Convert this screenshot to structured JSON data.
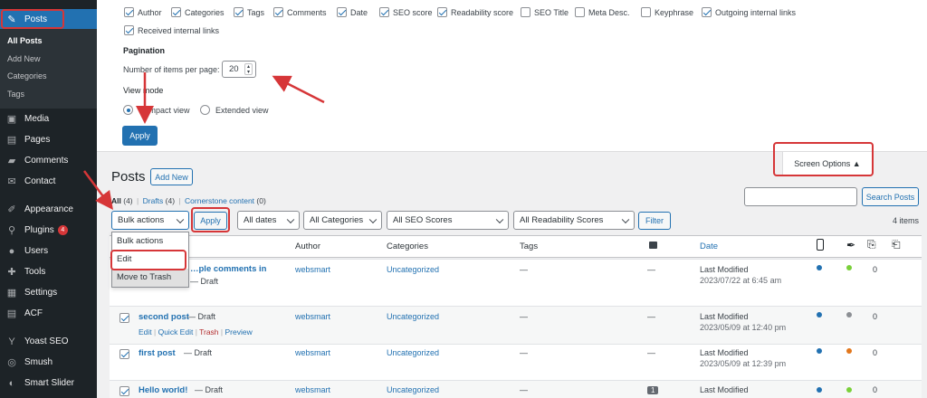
{
  "sidebar": {
    "items_top": [
      {
        "label": "Posts",
        "icon": "pushpin-icon",
        "current": true
      }
    ],
    "submenu": [
      "All Posts",
      "Add New",
      "Categories",
      "Tags"
    ],
    "items": [
      {
        "label": "Media",
        "icon": "media-icon"
      },
      {
        "label": "Pages",
        "icon": "pages-icon"
      },
      {
        "label": "Comments",
        "icon": "comments-icon"
      },
      {
        "label": "Contact",
        "icon": "mail-icon"
      },
      {
        "label": "Appearance",
        "icon": "brush-icon"
      },
      {
        "label": "Plugins",
        "icon": "plugin-icon",
        "badge": "4"
      },
      {
        "label": "Users",
        "icon": "users-icon"
      },
      {
        "label": "Tools",
        "icon": "wrench-icon"
      },
      {
        "label": "Settings",
        "icon": "settings-icon"
      },
      {
        "label": "ACF",
        "icon": "acf-icon"
      },
      {
        "label": "Yoast SEO",
        "icon": "yoast-icon"
      },
      {
        "label": "Smush",
        "icon": "smush-icon"
      },
      {
        "label": "Smart Slider",
        "icon": "slider-icon"
      }
    ]
  },
  "screen_options": {
    "columns": [
      {
        "label": "Author",
        "checked": true
      },
      {
        "label": "Categories",
        "checked": true
      },
      {
        "label": "Tags",
        "checked": true
      },
      {
        "label": "Comments",
        "checked": true
      },
      {
        "label": "Date",
        "checked": true
      },
      {
        "label": "SEO score",
        "checked": true
      },
      {
        "label": "Readability score",
        "checked": true
      },
      {
        "label": "SEO Title",
        "checked": false
      },
      {
        "label": "Meta Desc.",
        "checked": false
      },
      {
        "label": "Keyphrase",
        "checked": false
      },
      {
        "label": "Outgoing internal links",
        "checked": true
      },
      {
        "label": "Received internal links",
        "checked": true
      }
    ],
    "pagination_heading": "Pagination",
    "items_per_page_label": "Number of items per page:",
    "items_per_page_value": "20",
    "view_mode_heading": "View mode",
    "view_modes": [
      {
        "label": "Compact view",
        "selected": true
      },
      {
        "label": "Extended view",
        "selected": false
      }
    ],
    "apply_label": "Apply",
    "toggle_label": "Screen Options ▲"
  },
  "page": {
    "title": "Posts",
    "add_new_label": "Add New",
    "filters": {
      "all": "All",
      "all_count": "(4)",
      "drafts": "Drafts",
      "drafts_count": "(4)",
      "cornerstone": "Cornerstone content",
      "cornerstone_count": "(0)",
      "sep": "|"
    },
    "search_button": "Search Posts",
    "items_count": "4 items"
  },
  "toolbar": {
    "bulk_actions": "Bulk actions",
    "apply": "Apply",
    "dates": "All dates",
    "categories": "All Categories",
    "seo": "All SEO Scores",
    "readability": "All Readability Scores",
    "filter": "Filter"
  },
  "bulk_dropdown": {
    "options": [
      "Bulk actions",
      "Edit",
      "Move to Trash"
    ]
  },
  "table": {
    "headers": {
      "author": "Author",
      "categories": "Categories",
      "tags": "Tags",
      "date": "Date"
    },
    "rows": [
      {
        "title": "…ple comments in",
        "state": "— Draft",
        "author": "websmart",
        "category": "Uncategorized",
        "tags": "—",
        "comments": "—",
        "date_label": "Last Modified",
        "date": "2023/07/22 at 6:45 am",
        "seo_color": "#2271b1",
        "read_color": "#7ad03a",
        "links": "0",
        "checked": false
      },
      {
        "title": "second post",
        "state": "— Draft",
        "author": "websmart",
        "category": "Uncategorized",
        "tags": "—",
        "comments": "—",
        "date_label": "Last Modified",
        "date": "2023/05/09 at 12:40 pm",
        "seo_color": "#2271b1",
        "read_color": "#8c8f94",
        "links": "0",
        "checked": true,
        "actions": [
          "Edit",
          "Quick Edit",
          "Trash",
          "Preview"
        ]
      },
      {
        "title": "first post",
        "state": "— Draft",
        "author": "websmart",
        "category": "Uncategorized",
        "tags": "—",
        "comments": "—",
        "date_label": "Last Modified",
        "date": "2023/05/09 at 12:39 pm",
        "seo_color": "#2271b1",
        "read_color": "#e2771c",
        "links": "0",
        "checked": true
      },
      {
        "title": "Hello world!",
        "state": "— Draft",
        "author": "websmart",
        "category": "Uncategorized",
        "tags": "—",
        "comments": "1",
        "date_label": "Last Modified",
        "date": "",
        "seo_color": "#2271b1",
        "read_color": "#7ad03a",
        "links": "0",
        "checked": true
      }
    ]
  },
  "colors": {
    "accent": "#2271b1",
    "highlight": "#d63638",
    "sidebar": "#1d2327"
  }
}
